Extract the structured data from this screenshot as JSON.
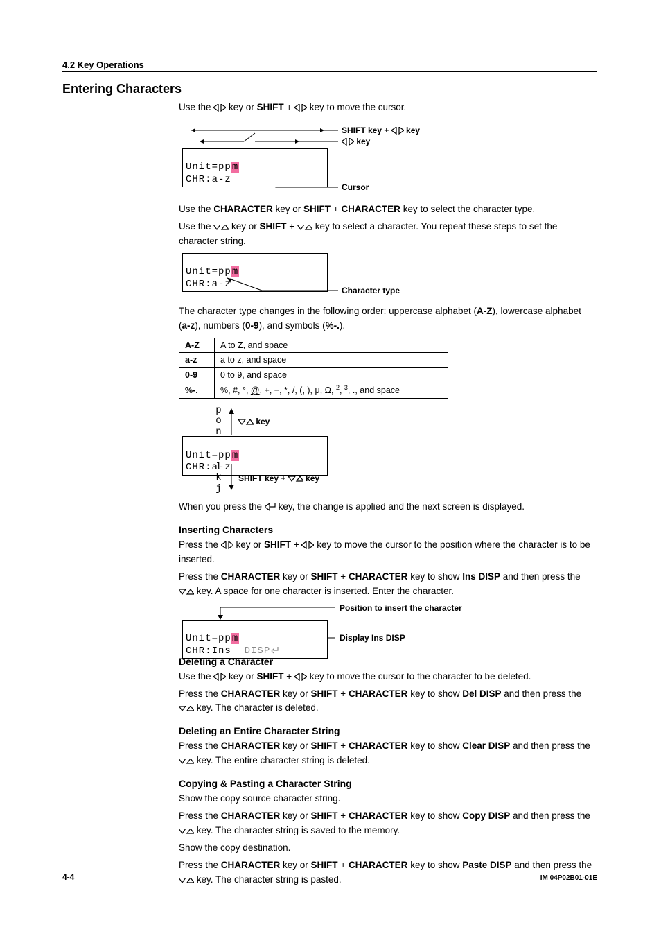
{
  "header": {
    "section": "4.2  Key Operations"
  },
  "title": "Entering Characters",
  "body": {
    "p1a": "Use the ",
    "p1b": " key or ",
    "p1c": "SHIFT",
    "p1d": " + ",
    "p1e": " key to move the cursor."
  },
  "fig1": {
    "ann_shift": "SHIFT key + ",
    "ann_shift2": " key",
    "ann_key": " key",
    "ann_cursor": "Cursor",
    "lcd_l1a": "Unit=pp",
    "lcd_l1b": "m",
    "lcd_l2": "CHR:a-z"
  },
  "body2": {
    "p1a": "Use the ",
    "p1b": "CHARACTER",
    "p1c": " key or ",
    "p1d": "SHIFT",
    "p1e": " + ",
    "p1f": "CHARACTER",
    "p1g": " key to select the character type.",
    "p2a": "Use the ",
    "p2b": " key or ",
    "p2c": "SHIFT",
    "p2d": " + ",
    "p2e": " key to select a character. You repeat these steps to set the character string."
  },
  "fig2": {
    "lcd_l1a": "Unit=pp",
    "lcd_l1b": "m",
    "lcd_l2": "CHR:a-z",
    "ann": "Character type"
  },
  "body3": {
    "p1a": "The character type changes in the following order: uppercase alphabet (",
    "p1b": "A-Z",
    "p1c": "), lowercase alphabet (",
    "p1d": "a-z",
    "p1e": "), numbers (",
    "p1f": "0-9",
    "p1g": "), and symbols (",
    "p1h": "%-.",
    "p1i": ")."
  },
  "table": {
    "r1k": "A-Z",
    "r1v": "A to Z, and space",
    "r2k": "a-z",
    "r2v": "a to z, and space",
    "r3k": "0-9",
    "r3v": "0 to 9, and space",
    "r4k": "%-.",
    "r4v_a": "%, #, °, ",
    "r4v_b": ", +, −, *, /, (, ), μ, Ω, ",
    "r4v_c": ", ",
    "r4v_d": ", ., and space"
  },
  "fig3": {
    "up": {
      "a": "p",
      "b": "o",
      "c": "n"
    },
    "down": {
      "a": "l",
      "b": "k",
      "c": "j"
    },
    "ann_up": " key",
    "ann_down_a": "SHIFT key + ",
    "ann_down_b": " key",
    "lcd_l1a": "Unit=pp",
    "lcd_l1b": "m",
    "lcd_l2": "CHR:a-z"
  },
  "body4": {
    "p1a": "When you press the ",
    "p1b": " key, the change is applied and the next screen is displayed."
  },
  "ins": {
    "head": "Inserting Characters",
    "p1a": "Press the ",
    "p1b": " key or ",
    "p1c": "SHIFT",
    "p1d": " + ",
    "p1e": " key to move the cursor to the position where the character is to be inserted.",
    "p2a": "Press the ",
    "p2b": "CHARACTER",
    "p2c": " key or ",
    "p2d": "SHIFT",
    "p2e": " + ",
    "p2f": "CHARACTER",
    "p2g": " key to show ",
    "p2h": "Ins DISP",
    "p2i": " and then press the ",
    "p2j": " key. A space for one character is inserted. Enter the character."
  },
  "fig4": {
    "lcd_l1a": "Unit=pp",
    "lcd_l1b": "m",
    "lcd_l2a": "CHR:Ins  ",
    "lcd_l2b": "DISP",
    "ann_pos": "Position to insert the character",
    "ann_disp": "Display Ins DISP"
  },
  "del": {
    "head": "Deleting a Character",
    "p1a": "Use the ",
    "p1b": " key or ",
    "p1c": "SHIFT",
    "p1d": " + ",
    "p1e": " key to move the cursor to the character to be deleted.",
    "p2a": "Press the ",
    "p2b": "CHARACTER",
    "p2c": " key or ",
    "p2d": "SHIFT",
    "p2e": " + ",
    "p2f": "CHARACTER",
    "p2g": " key to show ",
    "p2h": "Del DISP",
    "p2i": " and then press the ",
    "p2j": " key. The character is deleted."
  },
  "delall": {
    "head": "Deleting an Entire Character String",
    "p1a": "Press the ",
    "p1b": "CHARACTER",
    "p1c": " key or ",
    "p1d": "SHIFT",
    "p1e": " + ",
    "p1f": "CHARACTER",
    "p1g": " key to show ",
    "p1h": "Clear DISP",
    "p1i": " and then press the ",
    "p1j": " key. The entire character string is deleted."
  },
  "copy": {
    "head": "Copying & Pasting a Character String",
    "p0": "Show the copy source character string.",
    "p1a": "Press the ",
    "p1b": "CHARACTER",
    "p1c": " key or ",
    "p1d": "SHIFT",
    "p1e": " + ",
    "p1f": "CHARACTER",
    "p1g": " key to show ",
    "p1h": "Copy DISP",
    "p1i": " and then press the ",
    "p1j": " key. The character string is saved to the memory.",
    "p2": "Show the copy destination.",
    "p3a": "Press the ",
    "p3b": "CHARACTER",
    "p3c": " key or ",
    "p3d": "SHIFT",
    "p3e": " + ",
    "p3f": "CHARACTER",
    "p3g": " key to show ",
    "p3h": "Paste DISP",
    "p3i": " and then press the ",
    "p3j": " key. The character string is pasted."
  },
  "footer": {
    "page": "4-4",
    "doc": "IM 04P02B01-01E"
  }
}
